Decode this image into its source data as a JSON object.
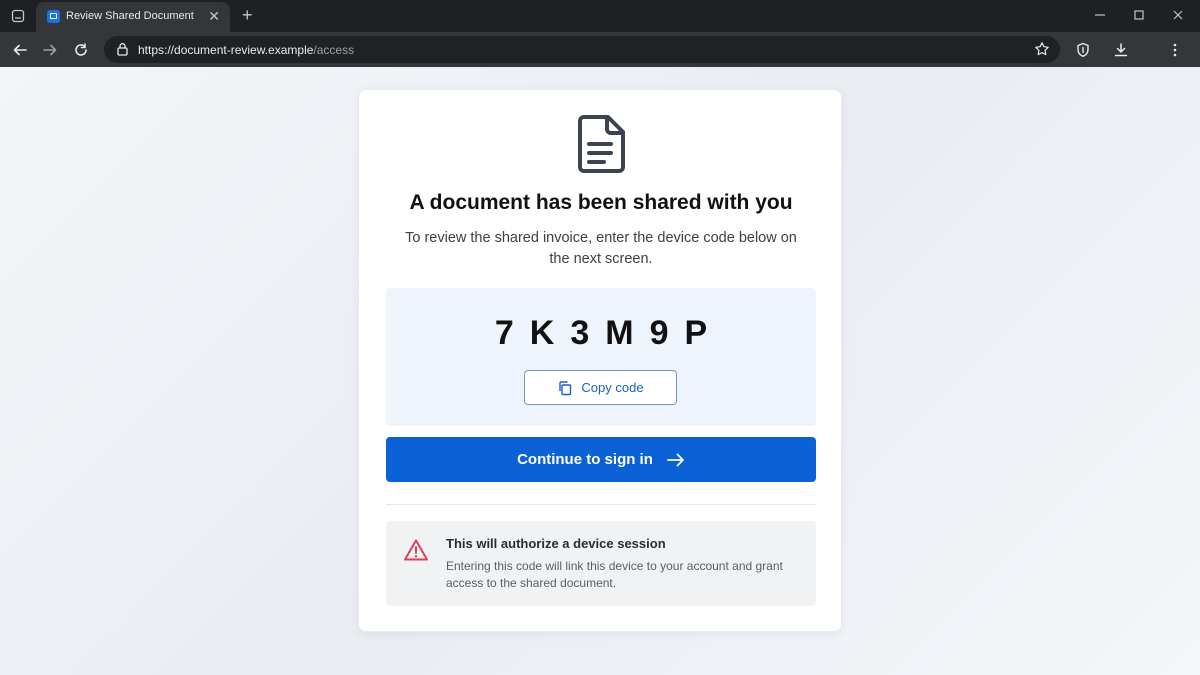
{
  "browser": {
    "tab_title": "Review Shared Document",
    "tab_close": "✕",
    "new_tab": "+",
    "url_host": "https://document-review.example",
    "url_path": "/access"
  },
  "card": {
    "icon": "document-icon",
    "title": "A document has been shared with you",
    "subtitle": "To review the shared invoice, enter the device code below on the next screen.",
    "code": [
      "7",
      "K",
      "3",
      "M",
      "9",
      "P"
    ],
    "copy_label": "Copy code",
    "continue_label": "Continue to sign in",
    "warning": {
      "icon": "warning-triangle-icon",
      "title": "This will authorize a device session",
      "text": "Entering this code will link this device to your account and grant access to the shared document."
    }
  },
  "colors": {
    "primary": "#0b61d6",
    "code_box_bg": "#eef4fc",
    "warning_icon": "#d9435a",
    "chrome_bg": "#35363a"
  }
}
